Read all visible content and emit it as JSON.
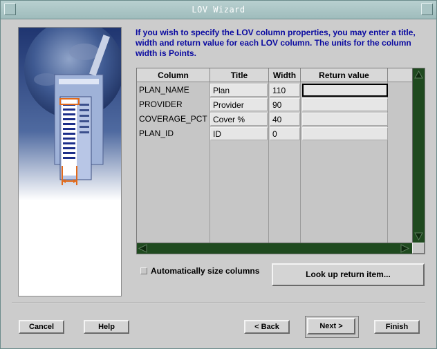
{
  "window": {
    "title": "LOV Wizard"
  },
  "instructions": "If you wish to specify the LOV column properties, you may enter a title, width and return value for each LOV column. The units for the column width is Points.",
  "table": {
    "headers": [
      "Column",
      "Title",
      "Width",
      "Return value"
    ],
    "rows": [
      {
        "column": "PLAN_NAME",
        "title": "Plan",
        "width": "110",
        "return_value": ""
      },
      {
        "column": "PROVIDER",
        "title": "Provider",
        "width": "90",
        "return_value": ""
      },
      {
        "column": "COVERAGE_PCT",
        "title": "Cover %",
        "width": "40",
        "return_value": ""
      },
      {
        "column": "PLAN_ID",
        "title": "ID",
        "width": "0",
        "return_value": ""
      }
    ]
  },
  "options": {
    "auto_size_label": "Automatically size columns",
    "auto_size_checked": false,
    "lookup_button": "Look up return item..."
  },
  "buttons": {
    "cancel": "Cancel",
    "help": "Help",
    "back": "< Back",
    "next": "Next >",
    "finish": "Finish"
  },
  "colors": {
    "instruction_text": "#0a0aa0",
    "scrollbar": "#1f4a1f",
    "title_bar": "#a9c4c4"
  }
}
